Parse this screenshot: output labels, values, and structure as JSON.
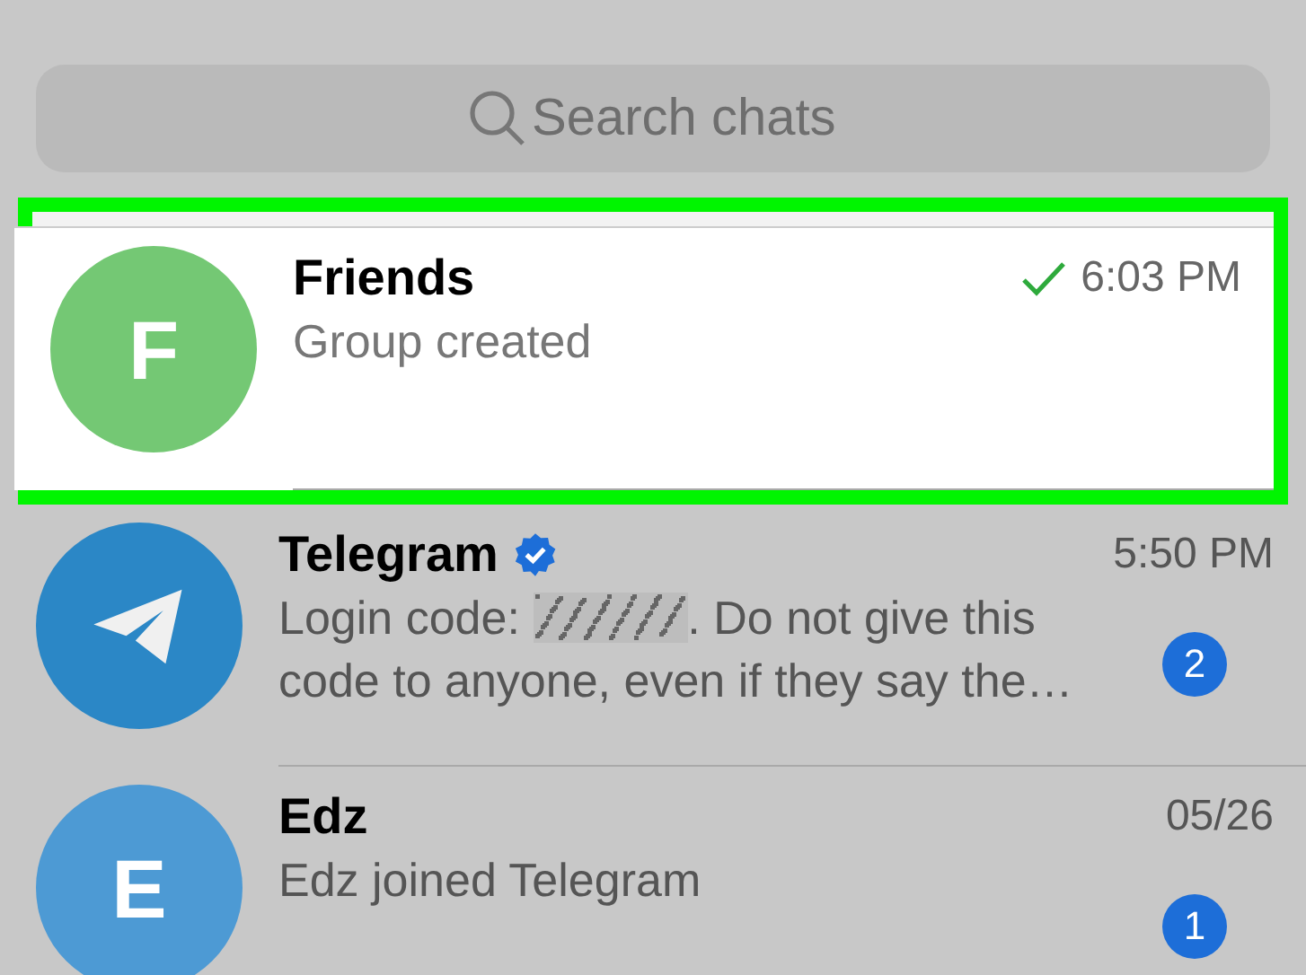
{
  "search": {
    "placeholder": "Search chats"
  },
  "chats": [
    {
      "name": "Friends",
      "kind": "letter",
      "initial": "F",
      "color": "#74c874",
      "verified": false,
      "read": true,
      "time": "6:03 PM",
      "highlighted": true,
      "preview": [
        {
          "kind": "text",
          "text": "Group created"
        }
      ]
    },
    {
      "name": "Telegram",
      "kind": "logo",
      "color": "#2b87c6",
      "verified": true,
      "read": false,
      "time": "5:50 PM",
      "highlighted": false,
      "unread": "2",
      "preview": [
        {
          "kind": "text",
          "text": "Login code: "
        },
        {
          "kind": "redacted"
        },
        {
          "kind": "text",
          "text": ". Do not give this code to anyone, even if they say the…"
        }
      ]
    },
    {
      "name": "Edz",
      "kind": "letter",
      "initial": "E",
      "color": "#4d9ad4",
      "verified": false,
      "read": false,
      "time": "05/26",
      "highlighted": false,
      "unread": "1",
      "preview": [
        {
          "kind": "text",
          "text": "Edz joined Telegram"
        }
      ]
    }
  ]
}
